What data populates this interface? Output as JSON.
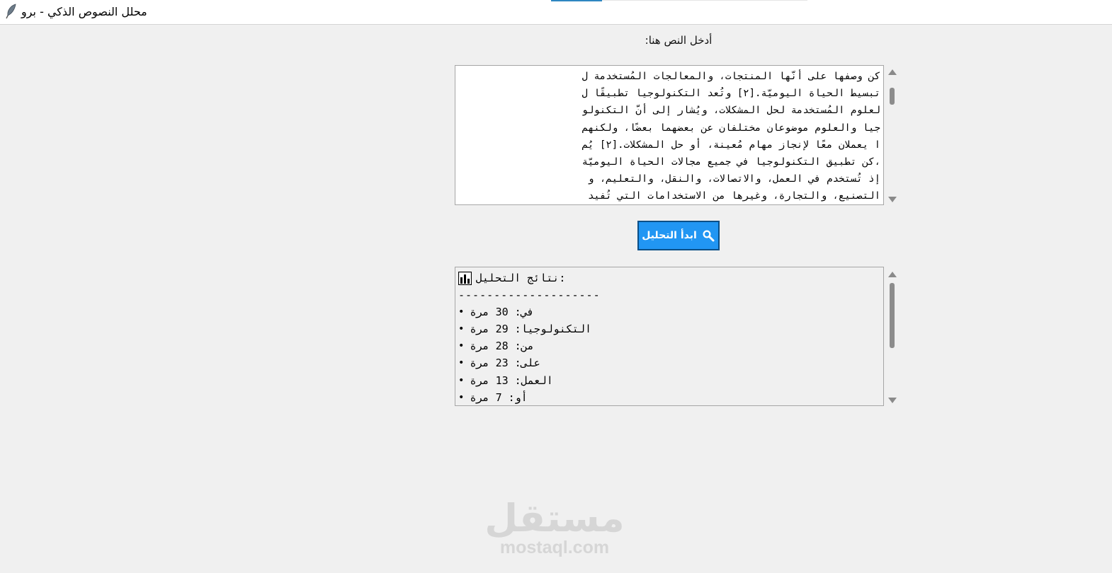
{
  "window": {
    "title": "محلل النصوص الذكي - برو",
    "app_icon": "feather-icon",
    "accent_color": "#2e86c1"
  },
  "input": {
    "label": ":أدخل النص هنا",
    "text_lines": [
      "كن وصفها على أنّها المنتجات، والمعالجات المُستخدمة ل",
      "تبسيط الحياة اليوميّة.[٢] وتُعد التكنولوجيا تطبيقًا ل",
      "لعلوم المُستخدمة لحل المشكلات، ويُشار إلى أنّ التكنولو",
      "جيا والعلوم موضوعان مختلفان عن بعضهما بعضًا، ولكنهم",
      "ا يعملان معًا لإنجاز مهام مُعينة، أو حل المشكلات.[٢] يُم",
      "،كن تطبيق التكنولوجيا في جميع مجالات الحياة اليوميّة",
      "إذ تُستخدم في العمل، والاتصالات، والنقل، والتعليم، و",
      "التصنيع، والتجارة، وغيرها من الاستخدامات التي تُفيد"
    ]
  },
  "analyze_button": {
    "label": "ابدأ التحليل",
    "icon": "magnifier-icon",
    "color": "#2196f3"
  },
  "results": {
    "title": ":نتائج التحليل",
    "icon": "bar-chart-icon",
    "divider": "--------------------",
    "items": [
      {
        "bullet": "•",
        "text": "في: 30 مرة"
      },
      {
        "bullet": "•",
        "text": "التكنولوجيا: 29 مرة"
      },
      {
        "bullet": "•",
        "text": "من: 28 مرة"
      },
      {
        "bullet": "•",
        "text": "على: 23 مرة"
      },
      {
        "bullet": "•",
        "text": "العمل: 13 مرة"
      },
      {
        "bullet": "•",
        "text": "أو: 7 مرة"
      }
    ]
  },
  "watermark": {
    "arabic": "مستقل",
    "latin": "mostaql.com"
  }
}
